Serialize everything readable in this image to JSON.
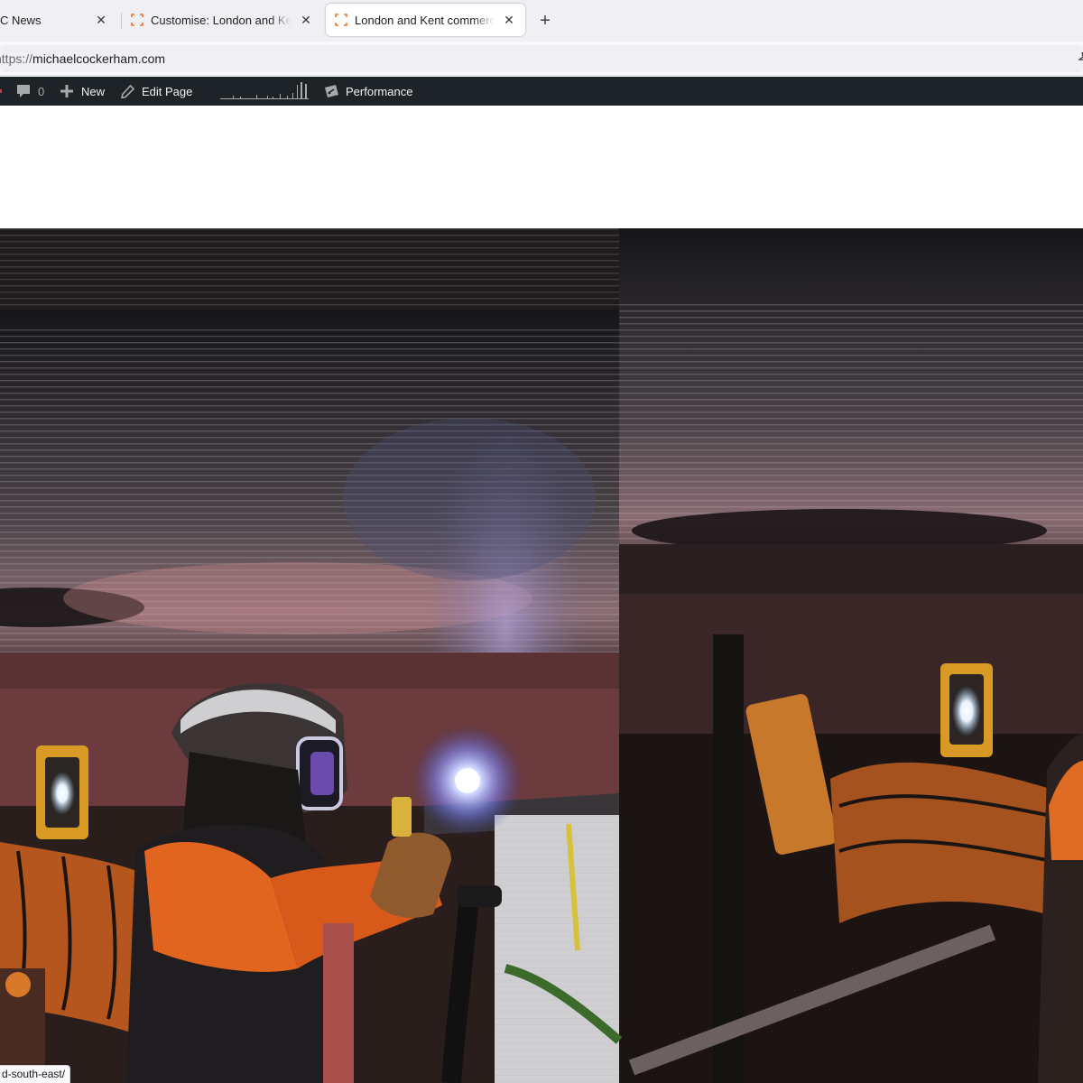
{
  "browser": {
    "tabs": [
      {
        "title": "C News",
        "active": false
      },
      {
        "title": "Customise: London and Kent commercial and industrial photography",
        "active": false
      },
      {
        "title": "London and Kent commercial and industrial photography",
        "active": true
      }
    ],
    "close_glyph": "✕",
    "new_tab_glyph": "+",
    "url": {
      "scheme": "https://",
      "host": "michaelcockerham.com"
    },
    "accent_tab_favicon": "#e8742a"
  },
  "admin_bar": {
    "comments": {
      "icon": "comment-bubble-icon",
      "count": "0"
    },
    "new": {
      "icon": "plus-icon",
      "label": "New"
    },
    "edit": {
      "icon": "pencil-icon",
      "label": "Edit Page"
    },
    "performance": {
      "icon": "gauge-icon",
      "label": "Performance"
    },
    "background": "#1d2327"
  },
  "status_bar": {
    "link": "d-south-east/"
  }
}
